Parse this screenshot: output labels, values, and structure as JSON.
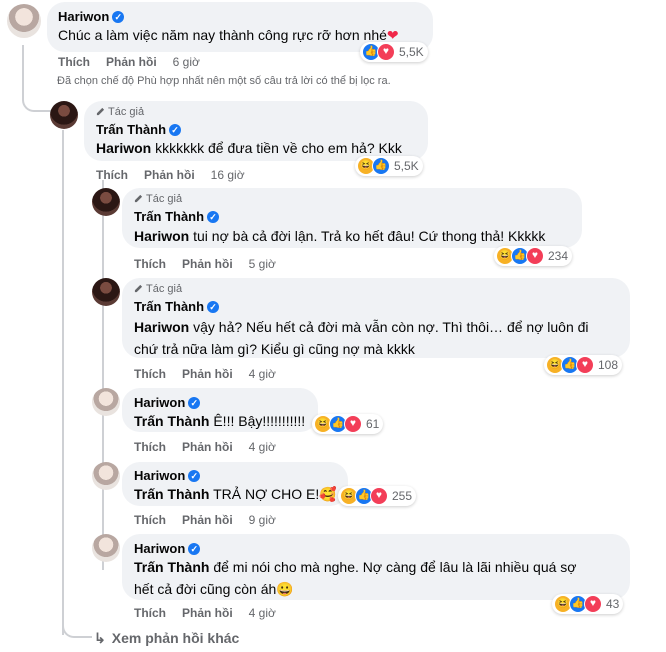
{
  "comments": [
    {
      "name": "Hariwon",
      "text": "Chúc a làm việc năm nay thành công rực rỡ hơn nhé",
      "emoji": "❤",
      "reaction_count": "5,5K",
      "like": "Thích",
      "reply": "Phản hồi",
      "time": "6 giờ"
    },
    {
      "author_badge": "Tác giả",
      "name": "Trấn Thành",
      "mention": "Hariwon",
      "text": " kkkkkkk để đưa tiền về cho em hả? Kkk",
      "reaction_count": "5,5K",
      "like": "Thích",
      "reply": "Phản hồi",
      "time": "16 giờ"
    },
    {
      "author_badge": "Tác giả",
      "name": "Trấn Thành",
      "mention": "Hariwon",
      "text": " tui nợ bà cả đời lận. Trả ko hết đâu! Cứ thong thả! Kkkkk",
      "reaction_count": "234",
      "like": "Thích",
      "reply": "Phản hồi",
      "time": "5 giờ"
    },
    {
      "author_badge": "Tác giả",
      "name": "Trấn Thành",
      "mention": "Hariwon",
      "text_line1": " vậy hả? Nếu hết cả đời mà vẫn còn nợ. Thì thôi… để nợ luôn đi",
      "text_line2": "chứ trả nữa làm gì? Kiểu gì cũng nợ mà kkkk",
      "reaction_count": "108",
      "like": "Thích",
      "reply": "Phản hồi",
      "time": "4 giờ"
    },
    {
      "name": "Hariwon",
      "mention": "Trấn Thành",
      "text": " Ê!!! Bậy!!!!!!!!!!!",
      "reaction_count": "61",
      "like": "Thích",
      "reply": "Phản hồi",
      "time": "4 giờ"
    },
    {
      "name": "Hariwon",
      "mention": "Trấn Thành",
      "text": " TRẢ NỢ CHO E!",
      "emoji": "🥰",
      "reaction_count": "255",
      "like": "Thích",
      "reply": "Phản hồi",
      "time": "9 giờ"
    },
    {
      "name": "Hariwon",
      "mention": "Trấn Thành",
      "text_line1": " để mi nói cho mà nghe. Nợ càng để lâu là lãi nhiều quá sợ",
      "text_line2": "hết cả đời cũng còn áh",
      "emoji": "😀",
      "reaction_count": "43",
      "like": "Thích",
      "reply": "Phản hồi",
      "time": "4 giờ"
    }
  ],
  "filter_notice": "Đã chọn chế độ Phù hợp nhất nên một số câu trả lời có thể bị lọc ra.",
  "more_replies": "Xem phản hồi khác",
  "colors": {
    "verified": "#1877f2",
    "like": "#1877f2",
    "love": "#f33e58",
    "haha": "#f7b125",
    "bubble": "#f0f2f5",
    "meta": "#65676b"
  },
  "icons": {
    "verified": "check-badge",
    "author": "pencil",
    "more": "reply-arrow"
  }
}
